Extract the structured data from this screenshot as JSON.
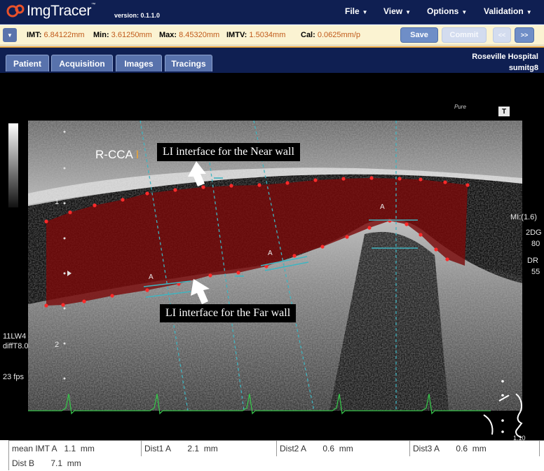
{
  "app": {
    "name": "ImgTracer",
    "trademark": "™",
    "version": "version: 0.1.1.0"
  },
  "menu": [
    {
      "label": "File",
      "icon": "caret-down-icon"
    },
    {
      "label": "View",
      "icon": "caret-down-icon"
    },
    {
      "label": "Options",
      "icon": "caret-down-icon"
    },
    {
      "label": "Validation",
      "icon": "caret-down-icon"
    }
  ],
  "measurements": {
    "imt_label": "IMT:",
    "imt_value": "6.84122mm",
    "min_label": "Min:",
    "min_value": "3.61250mm",
    "max_label": "Max:",
    "max_value": "8.45320mm",
    "imtv_label": "IMTV:",
    "imtv_value": "1.5034mm",
    "cal_label": "Cal:",
    "cal_value": "0.0625mm/p"
  },
  "buttons": {
    "save": "Save",
    "commit": "Commit",
    "prev": "<<",
    "next": ">>"
  },
  "tabs": [
    "Patient",
    "Acquisition",
    "Images",
    "Tracings"
  ],
  "hospital": {
    "name": "Roseville Hospital",
    "user": "sumitg8"
  },
  "image": {
    "vessel_label": "R-CCA",
    "vessel_marker": "I",
    "brand_logo": "Pure",
    "t_badge": "T",
    "depth_marks": [
      "1",
      "2"
    ],
    "left_info": [
      "11LW4",
      "diffT8.0"
    ],
    "fps": "23 fps",
    "right_info": [
      "MI:(1.6)",
      "2DG",
      "80",
      "DR",
      "55"
    ],
    "probe_mark": "1.10",
    "line_markers": [
      "A",
      "A",
      "A"
    ],
    "annotation_near": "LI interface for the Near wall",
    "annotation_far": "LI interface for the Far wall",
    "colors": {
      "roi_fill": "#7a0a0a",
      "trace_points": "#ff2a2a",
      "guide_lines": "#3fb4c0",
      "ecg": "#37c24a"
    }
  },
  "stats": {
    "mean_imt_label": "mean IMT A",
    "mean_imt_value": "1.1",
    "mean_imt_unit": "mm",
    "dist1_label": "Dist1 A",
    "dist1_value": "2.1",
    "dist1_unit": "mm",
    "dist2_label": "Dist2 A",
    "dist2_value": "0.6",
    "dist2_unit": "mm",
    "dist3_label": "Dist3 A",
    "dist3_value": "0.6",
    "dist3_unit": "mm",
    "distb_label": "Dist B",
    "distb_value": "7.1",
    "distb_unit": "mm"
  }
}
